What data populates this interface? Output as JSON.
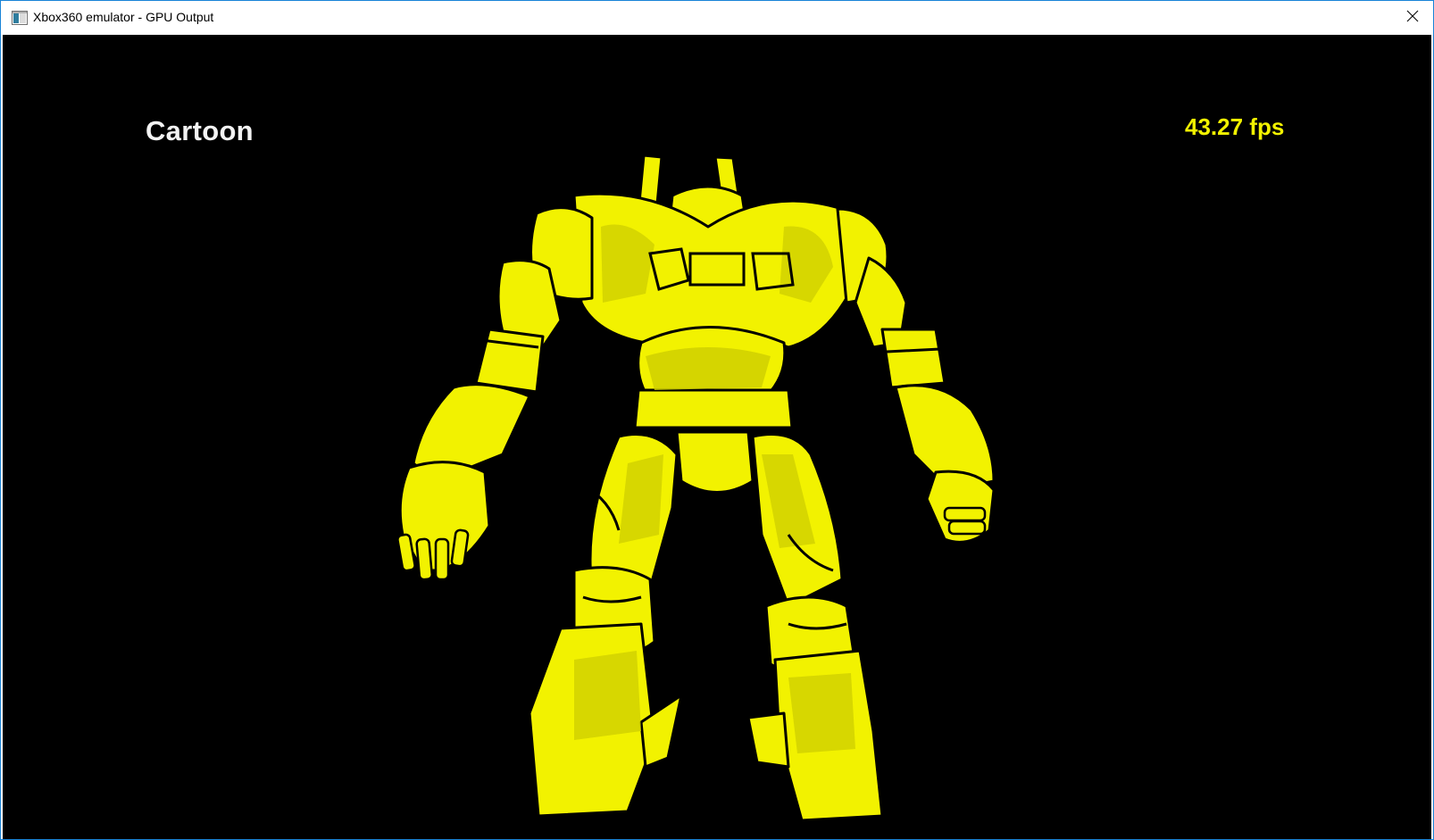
{
  "window": {
    "title": "Xbox360 emulator - GPU Output",
    "icon": "app-window-icon",
    "close_icon": "close-icon"
  },
  "viewport": {
    "mode_label": "Cartoon",
    "fps_label": "43.27 fps",
    "background": "#000000",
    "model_color": "#f2f200",
    "model_shade": "#c9c900",
    "outline_color": "#000000"
  }
}
